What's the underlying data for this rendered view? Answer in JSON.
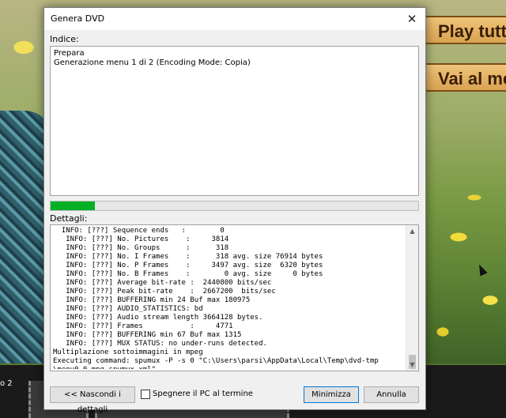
{
  "background": {
    "menu_buttons": [
      "Play tutto",
      "Vai al menu"
    ],
    "filmstrip_label": "o 2"
  },
  "dialog": {
    "title": "Genera DVD",
    "close_glyph": "✕",
    "indice_label": "Indice:",
    "indice_lines": [
      "Prepara",
      "Generazione menu 1 di 2 (Encoding Mode: Copia)"
    ],
    "progress_fraction": 0.12,
    "dettagli_label": "Dettagli:",
    "log_lines": [
      "  INFO: [???] Sequence ends   :        0",
      "   INFO: [???] No. Pictures    :     3814",
      "   INFO: [???] No. Groups      :      318",
      "   INFO: [???] No. I Frames    :      318 avg. size 76914 bytes",
      "   INFO: [???] No. P Frames    :     3497 avg. size  6320 bytes",
      "   INFO: [???] No. B Frames    :        0 avg. size     0 bytes",
      "   INFO: [???] Average bit-rate :  2440800 bits/sec",
      "   INFO: [???] Peak bit-rate    :  2667200  bits/sec",
      "   INFO: [???] BUFFERING min 24 Buf max 180975",
      "   INFO: [???] AUDIO_STATISTICS: bd",
      "   INFO: [???] Audio stream length 3664128 bytes.",
      "   INFO: [???] Frames           :     4771",
      "   INFO: [???] BUFFERING min 67 Buf max 1315",
      "   INFO: [???] MUX STATUS: no under-runs detected.",
      "Multiplazione sottoimmagini in mpeg",
      "Executing command: spumux -P -s 0 \"C:\\Users\\parsi\\AppData\\Local\\Temp\\dvd-tmp",
      "\\menu0-0.mpg_spumux.xml\""
    ],
    "hide_details_button": "<< Nascondi i dettagli",
    "shutdown_checkbox_label": "Spegnere il PC al termine",
    "shutdown_checked": false,
    "minimize_button": "Minimizza",
    "cancel_button": "Annulla"
  }
}
